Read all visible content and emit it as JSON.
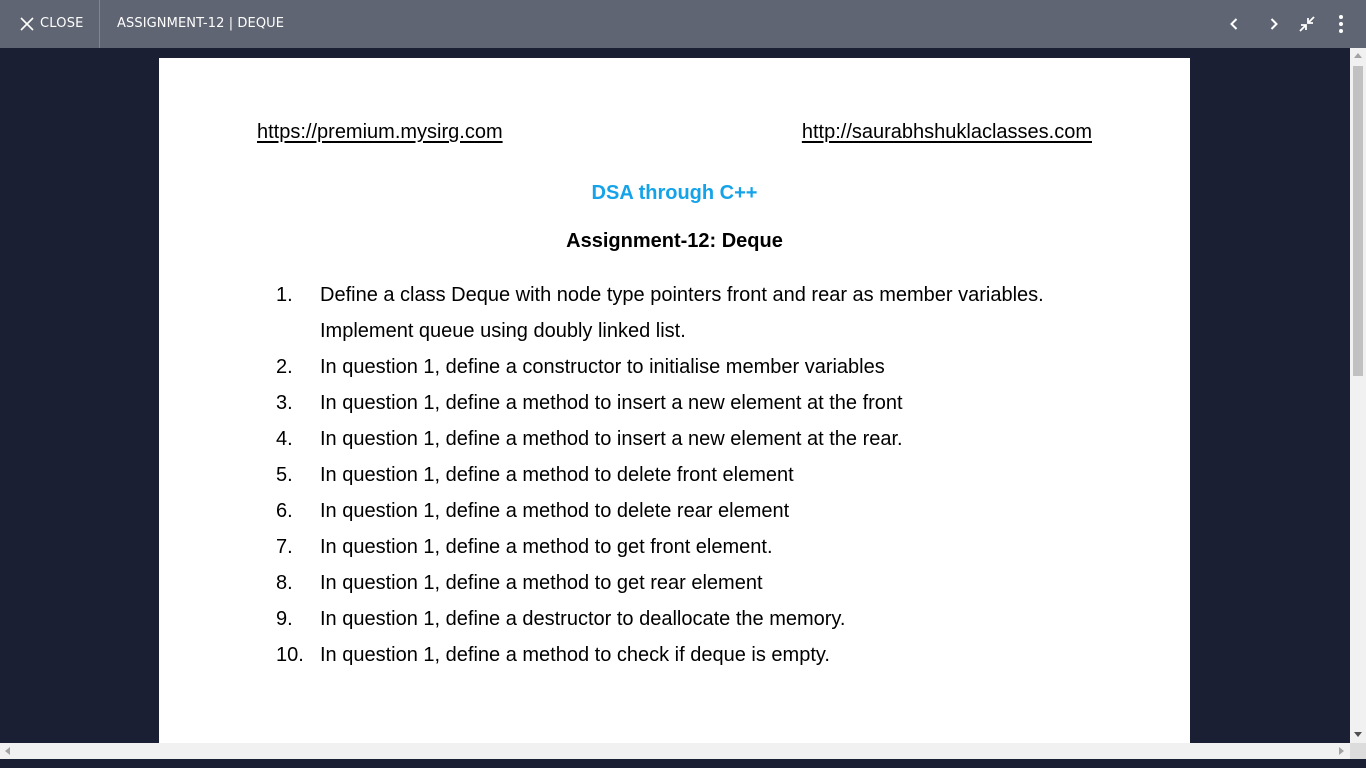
{
  "toolbar": {
    "close_label": "CLOSE",
    "document_title": "ASSIGNMENT-12 | DEQUE",
    "icons": [
      "close-icon",
      "chevron-left-icon",
      "chevron-right-icon",
      "exit-fullscreen-icon",
      "more-vert-icon"
    ]
  },
  "document": {
    "link_left": "https://premium.mysirg.com",
    "link_right": "http://saurabhshuklaclasses.com",
    "subject": "DSA through C++",
    "title": "Assignment-12: Deque",
    "questions": [
      {
        "num": "1.",
        "line1": "Define a class Deque with node type pointers front and rear as member variables.",
        "line2": "Implement queue using doubly linked list."
      },
      {
        "num": "2.",
        "line1": "In question 1, define a constructor to initialise member variables"
      },
      {
        "num": "3.",
        "line1": "In question 1, define a method to insert a new element at the front"
      },
      {
        "num": "4.",
        "line1": "In question 1, define a method to insert a new element at the rear."
      },
      {
        "num": "5.",
        "line1": "In question 1, define a method to delete front element"
      },
      {
        "num": "6.",
        "line1": "In question 1, define a method to delete rear element"
      },
      {
        "num": "7.",
        "line1": "In question 1, define a method to get front element."
      },
      {
        "num": "8.",
        "line1": "In question 1, define a method to get rear element"
      },
      {
        "num": "9.",
        "line1": "In question 1, define a destructor to deallocate the memory."
      },
      {
        "num": "10.",
        "line1": "In question 1, define a method to check if deque is empty."
      }
    ]
  },
  "colors": {
    "toolbar_bg": "#5f6573",
    "viewer_bg": "#1b1f33",
    "subject_blue": "#14a3e8"
  }
}
